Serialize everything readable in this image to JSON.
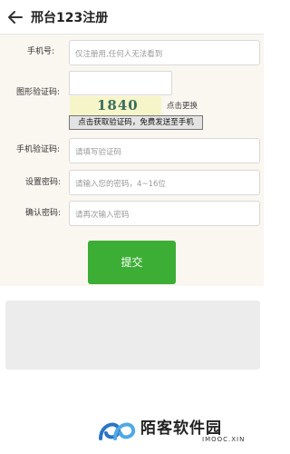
{
  "header": {
    "title": "邢台123注册",
    "back_icon": "arrow-left-icon"
  },
  "form": {
    "phone_label": "手机号:",
    "phone_placeholder": "仅注册用,任何人无法看到",
    "captcha_label": "图形验证码:",
    "captcha_value": "",
    "captcha_image_text": "1840",
    "refresh_label": "点击更换",
    "send_code_label": "点击获取验证码，免费发送至手机",
    "sms_label": "手机验证码:",
    "sms_placeholder": "请填写验证码",
    "password_label": "设置密码:",
    "password_placeholder": "请输入您的密码，4~16位",
    "confirm_label": "确认密码:",
    "confirm_placeholder": "请再次输入密码",
    "submit_label": "提交"
  },
  "watermark": {
    "name": "陌客软件园",
    "subtitle": "IMOOC.XIN"
  },
  "colors": {
    "accent_green": "#3cae35",
    "form_background": "#faf6f0",
    "captcha_background": "#f6f5c9"
  }
}
